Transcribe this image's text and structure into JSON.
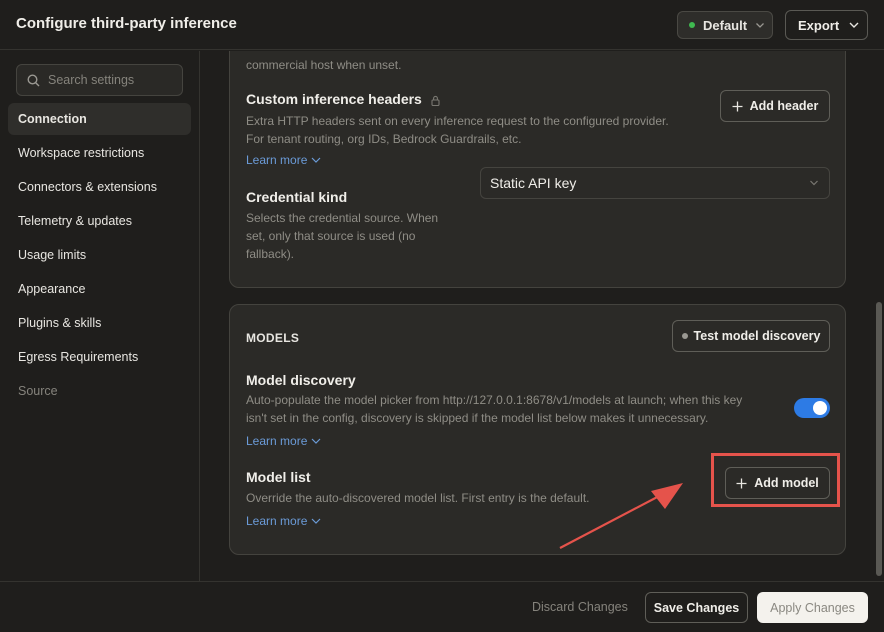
{
  "window": {
    "title": "Configure third-party inference"
  },
  "header": {
    "profile_label": "Default",
    "profile_status_color": "#3fb950",
    "export_label": "Export"
  },
  "sidebar": {
    "search_placeholder": "Search settings",
    "items": [
      {
        "label": "Connection",
        "active": true
      },
      {
        "label": "Workspace restrictions"
      },
      {
        "label": "Connectors & extensions"
      },
      {
        "label": "Telemetry & updates"
      },
      {
        "label": "Usage limits"
      },
      {
        "label": "Appearance"
      },
      {
        "label": "Plugins & skills"
      },
      {
        "label": "Egress Requirements"
      },
      {
        "label": "Source",
        "muted": true
      }
    ]
  },
  "connection_card": {
    "truncated_desc": "commercial host when unset.",
    "headers": {
      "title": "Custom inference headers",
      "desc_line1": "Extra HTTP headers sent on every inference request to the configured provider.",
      "desc_line2": "For tenant routing, org IDs, Bedrock Guardrails, etc.",
      "learn_more": "Learn more",
      "add_button": "Add header"
    },
    "credential": {
      "title": "Credential kind",
      "desc_line1": "Selects the credential source. When",
      "desc_line2": "set, only that source is used (no",
      "desc_line3": "fallback).",
      "selected": "Static API key"
    }
  },
  "models_card": {
    "section_label": "MODELS",
    "test_button": "Test model discovery",
    "discovery": {
      "title": "Model discovery",
      "desc_line1": "Auto-populate the model picker from http://127.0.0.1:8678/v1/models at launch; when this key",
      "desc_line2": "isn't set in the config, discovery is skipped if the model list below makes it unnecessary.",
      "learn_more": "Learn more",
      "enabled": true,
      "toggle_color": "#2d7be5"
    },
    "model_list": {
      "title": "Model list",
      "desc": "Override the auto-discovered model list. First entry is the default.",
      "learn_more": "Learn more",
      "add_button": "Add model"
    }
  },
  "annotation": {
    "color": "#e5534b"
  },
  "footer": {
    "discard_label": "Discard Changes",
    "save_label": "Save Changes",
    "apply_label": "Apply Changes"
  }
}
